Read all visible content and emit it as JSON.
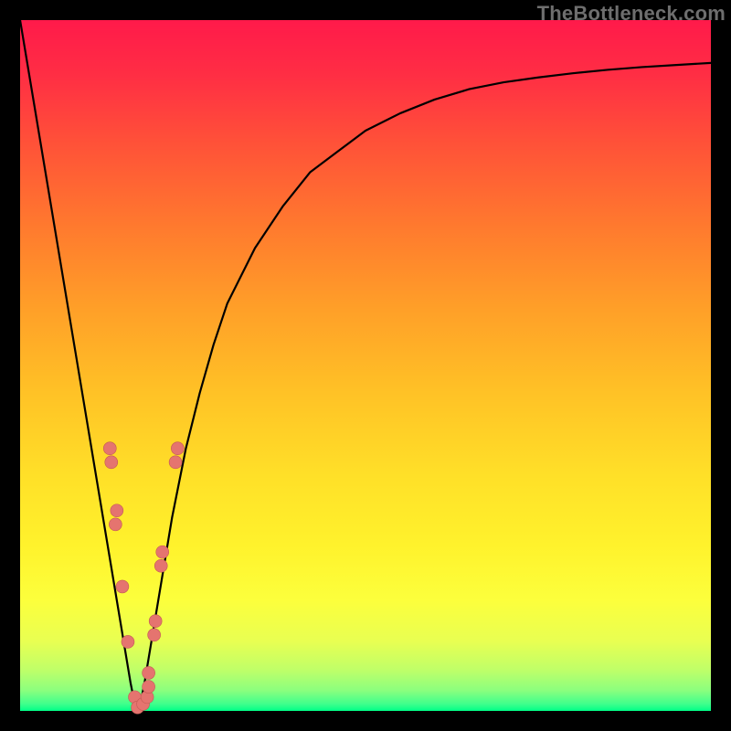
{
  "watermark": "TheBottleneck.com",
  "colors": {
    "curve_stroke": "#000000",
    "dot_fill": "#e5746f",
    "dot_stroke": "#c25a55"
  },
  "chart_data": {
    "type": "line",
    "title": "",
    "xlabel": "",
    "ylabel": "",
    "xlim": [
      0,
      100
    ],
    "ylim": [
      0,
      100
    ],
    "grid": false,
    "legend": false,
    "annotations": [
      "TheBottleneck.com"
    ],
    "series": [
      {
        "name": "bottleneck-curve",
        "x": [
          0,
          2,
          4,
          6,
          8,
          10,
          12,
          14,
          15,
          16,
          16.5,
          17,
          17.5,
          18,
          19,
          20,
          21,
          22,
          24,
          26,
          28,
          30,
          34,
          38,
          42,
          46,
          50,
          55,
          60,
          65,
          70,
          75,
          80,
          85,
          90,
          95,
          100
        ],
        "y": [
          100,
          88,
          76,
          64,
          52,
          40,
          28,
          16,
          10,
          4,
          1.5,
          0,
          1.5,
          4,
          10,
          16,
          22,
          28,
          38,
          46,
          53,
          59,
          67,
          73,
          78,
          81,
          84,
          86.5,
          88.5,
          90,
          91,
          91.7,
          92.3,
          92.8,
          93.2,
          93.5,
          93.8
        ]
      }
    ],
    "points": {
      "name": "sample-dots",
      "data": [
        {
          "x": 13.0,
          "y": 38
        },
        {
          "x": 13.2,
          "y": 36
        },
        {
          "x": 14.0,
          "y": 29
        },
        {
          "x": 13.8,
          "y": 27
        },
        {
          "x": 14.8,
          "y": 18
        },
        {
          "x": 15.6,
          "y": 10
        },
        {
          "x": 16.6,
          "y": 2
        },
        {
          "x": 17.0,
          "y": 0.5
        },
        {
          "x": 17.8,
          "y": 1
        },
        {
          "x": 18.4,
          "y": 2
        },
        {
          "x": 18.6,
          "y": 3.5
        },
        {
          "x": 18.6,
          "y": 5.5
        },
        {
          "x": 19.4,
          "y": 11
        },
        {
          "x": 19.6,
          "y": 13
        },
        {
          "x": 20.4,
          "y": 21
        },
        {
          "x": 20.6,
          "y": 23
        },
        {
          "x": 22.5,
          "y": 36
        },
        {
          "x": 22.8,
          "y": 38
        }
      ]
    }
  }
}
